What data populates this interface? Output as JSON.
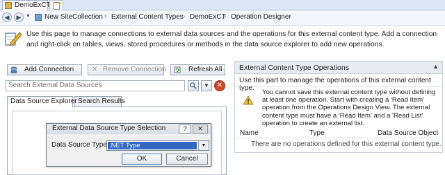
{
  "tab": {
    "title": "DemoExCT *"
  },
  "breadcrumb": [
    "New SiteCollection",
    "External Content Types",
    "DemoExCT",
    "Operation Designer"
  ],
  "info_text": "Use this page to manage connections to external data sources and the operations for this external content type. Add a connection and right-click on tables, views, stored procedures or methods in the data source explorer to add new operations.",
  "toolbar": {
    "add_connection": "Add Connection",
    "remove_connection": "Remove Connection",
    "refresh_all": "Refresh All"
  },
  "search": {
    "placeholder": "Search External Data Sources"
  },
  "tabs": {
    "explorer": "Data Source Explorer",
    "results": "Search Results"
  },
  "dialog": {
    "title": "External Data Source Type Selection",
    "help": "?",
    "label": "Data Source Type",
    "selected": ".NET Type",
    "ok": "OK",
    "cancel": "Cancel"
  },
  "ops": {
    "title": "External Content Type Operations",
    "description": "Use this part to manage the operations of this external content type.",
    "warning": "You cannot save this external content type without defining at least one operation. Start with creating a 'Read Item' operation from the Operations Design View. The external content type must have a 'Read Item' and a 'Read List' operation to create an external list.",
    "columns": [
      "Name",
      "Type",
      "Data Source Object"
    ],
    "empty": "There are no operations defined for this external content type."
  }
}
